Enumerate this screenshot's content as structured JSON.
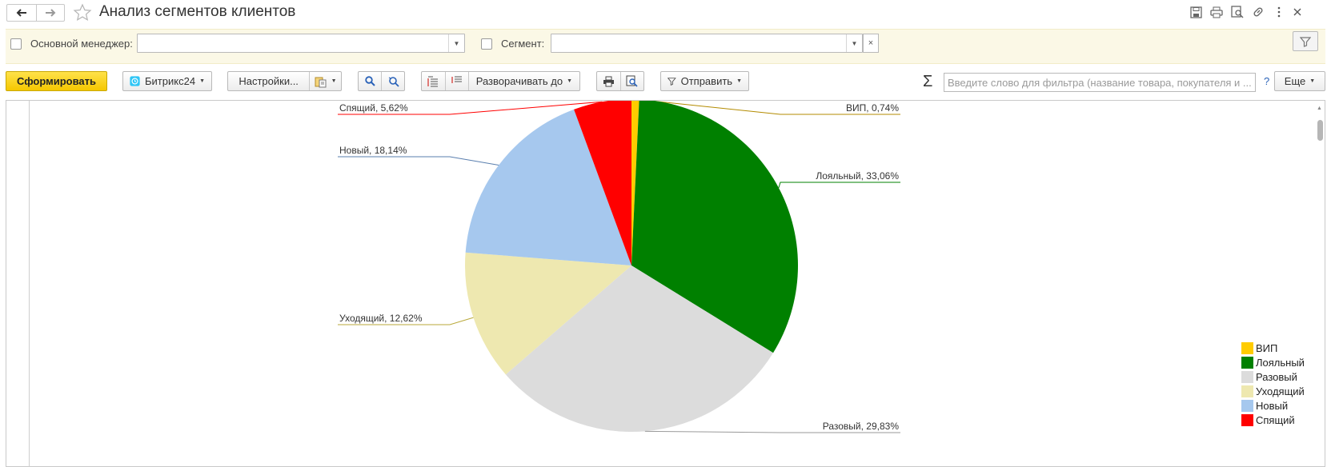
{
  "window": {
    "title": "Анализ сегментов клиентов"
  },
  "filters": {
    "manager_label": "Основной менеджер:",
    "manager_value": "",
    "segment_label": "Сегмент:",
    "segment_value": "",
    "clear_glyph": "×"
  },
  "toolbar": {
    "generate_label": "Сформировать",
    "bitrix_label": "Битрикс24",
    "settings_label": "Настройки...",
    "expand_label": "Разворачивать до",
    "send_label": "Отправить",
    "search_placeholder": "Введите слово для фильтра (название товара, покупателя и ...",
    "help_label": "?",
    "more_label": "Еще"
  },
  "chart_data": {
    "type": "pie",
    "slices": [
      {
        "name": "ВИП",
        "value": 0.74,
        "label": "ВИП, 0,74%",
        "color": "#ffcc00"
      },
      {
        "name": "Лояльный",
        "value": 33.06,
        "label": "Лояльный, 33,06%",
        "color": "#008000"
      },
      {
        "name": "Разовый",
        "value": 29.83,
        "label": "Разовый, 29,83%",
        "color": "#dcdcdc"
      },
      {
        "name": "Уходящий",
        "value": 12.62,
        "label": "Уходящий, 12,62%",
        "color": "#eee8b0"
      },
      {
        "name": "Новый",
        "value": 18.14,
        "label": "Новый, 18,14%",
        "color": "#a6c8ee"
      },
      {
        "name": "Спящий",
        "value": 5.62,
        "label": "Спящий, 5,62%",
        "color": "#ff0000"
      }
    ],
    "legend": [
      "ВИП",
      "Лояльный",
      "Разовый",
      "Уходящий",
      "Новый",
      "Спящий"
    ],
    "legend_position": "right"
  }
}
